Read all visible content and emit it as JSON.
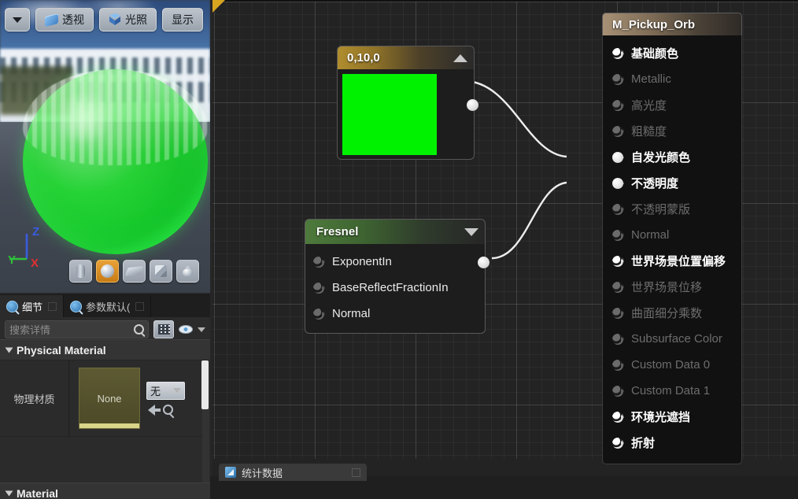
{
  "viewport": {
    "toolbar": [
      {
        "name": "viewport-options-dropdown",
        "label": "",
        "icon": "chevron-down-icon"
      },
      {
        "name": "perspective-button",
        "label": "透视",
        "icon": "perspective-icon"
      },
      {
        "name": "lighting-button",
        "label": "光照",
        "icon": "cube-icon"
      },
      {
        "name": "show-button",
        "label": "显示",
        "icon": ""
      }
    ],
    "shapes": [
      {
        "name": "preview-shape-cylinder",
        "icon": "cylinder-icon",
        "active": false
      },
      {
        "name": "preview-shape-sphere",
        "icon": "sphere-icon",
        "active": true
      },
      {
        "name": "preview-shape-plane",
        "icon": "plane-icon",
        "active": false
      },
      {
        "name": "preview-shape-cube",
        "icon": "cube-shape-icon",
        "active": false
      },
      {
        "name": "preview-shape-teapot",
        "icon": "teapot-icon",
        "active": false
      }
    ],
    "gizmo": {
      "x": "X",
      "y": "Y",
      "z": "Z",
      "x_color": "#e03030",
      "y_color": "#2fc23a",
      "z_color": "#3a5ce0"
    }
  },
  "details": {
    "tabs": [
      {
        "label": "细节",
        "active": true
      },
      {
        "label": "参数默认(",
        "active": false
      }
    ],
    "search_placeholder": "搜索详情",
    "search_value": "",
    "sections": [
      {
        "label": "Physical Material"
      },
      {
        "label": "Material"
      }
    ],
    "physical_material": {
      "row_label": "物理材质",
      "thumbnail_text": "None",
      "select_value": "无"
    }
  },
  "graph": {
    "statistics_tab": "统计数据",
    "nodes": {
      "constant": {
        "title": "0,10,0",
        "color_hex": "#00f200",
        "collapse_state": "expanded"
      },
      "fresnel": {
        "title": "Fresnel",
        "inputs": [
          "ExponentIn",
          "BaseReflectFractionIn",
          "Normal"
        ],
        "collapse_state": "collapsed"
      },
      "material": {
        "title": "M_Pickup_Orb",
        "pins": [
          {
            "label": "基础颜色",
            "enabled": true,
            "connected": false
          },
          {
            "label": "Metallic",
            "enabled": false,
            "connected": false
          },
          {
            "label": "高光度",
            "enabled": false,
            "connected": false
          },
          {
            "label": "粗糙度",
            "enabled": false,
            "connected": false
          },
          {
            "label": "自发光颜色",
            "enabled": true,
            "connected": true
          },
          {
            "label": "不透明度",
            "enabled": true,
            "connected": true
          },
          {
            "label": "不透明蒙版",
            "enabled": false,
            "connected": false
          },
          {
            "label": "Normal",
            "enabled": false,
            "connected": false
          },
          {
            "label": "世界场景位置偏移",
            "enabled": true,
            "connected": false
          },
          {
            "label": "世界场景位移",
            "enabled": false,
            "connected": false
          },
          {
            "label": "曲面细分乘数",
            "enabled": false,
            "connected": false
          },
          {
            "label": "Subsurface Color",
            "enabled": false,
            "connected": false
          },
          {
            "label": "Custom Data 0",
            "enabled": false,
            "connected": false
          },
          {
            "label": "Custom Data 1",
            "enabled": false,
            "connected": false
          },
          {
            "label": "环境光遮挡",
            "enabled": true,
            "connected": false
          },
          {
            "label": "折射",
            "enabled": true,
            "connected": false
          }
        ]
      }
    }
  }
}
